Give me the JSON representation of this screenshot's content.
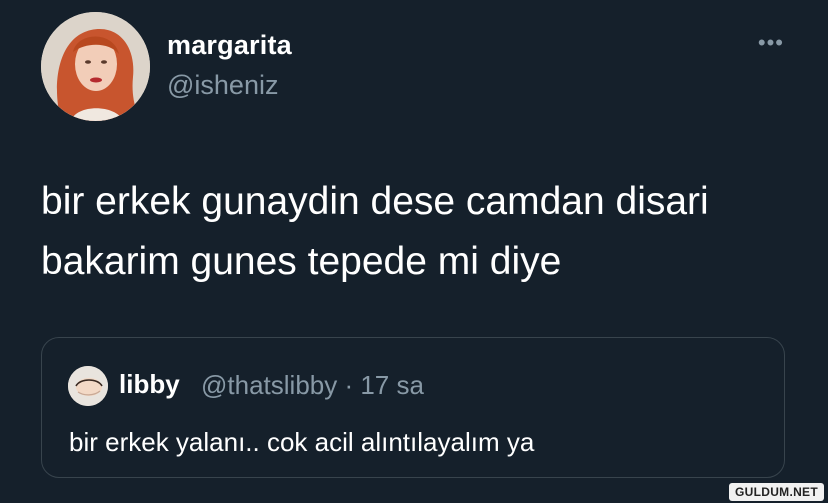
{
  "tweet": {
    "author_name": "margarita",
    "author_handle": "@isheniz",
    "more_icon": "more-horizontal-icon",
    "text": "bir erkek gunaydin dese camdan disari bakarim gunes tepede mi diye"
  },
  "quoted_tweet": {
    "author_name": "libby",
    "author_meta": "@thatslibby · 17 sa",
    "text": "bir erkek yalanı.. cok acil alıntılayalım ya"
  },
  "watermark": "GULDUM.NET",
  "colors": {
    "background": "#15202b",
    "text_primary": "#ffffff",
    "text_secondary": "#8899a6",
    "card_border": "#38444d"
  }
}
